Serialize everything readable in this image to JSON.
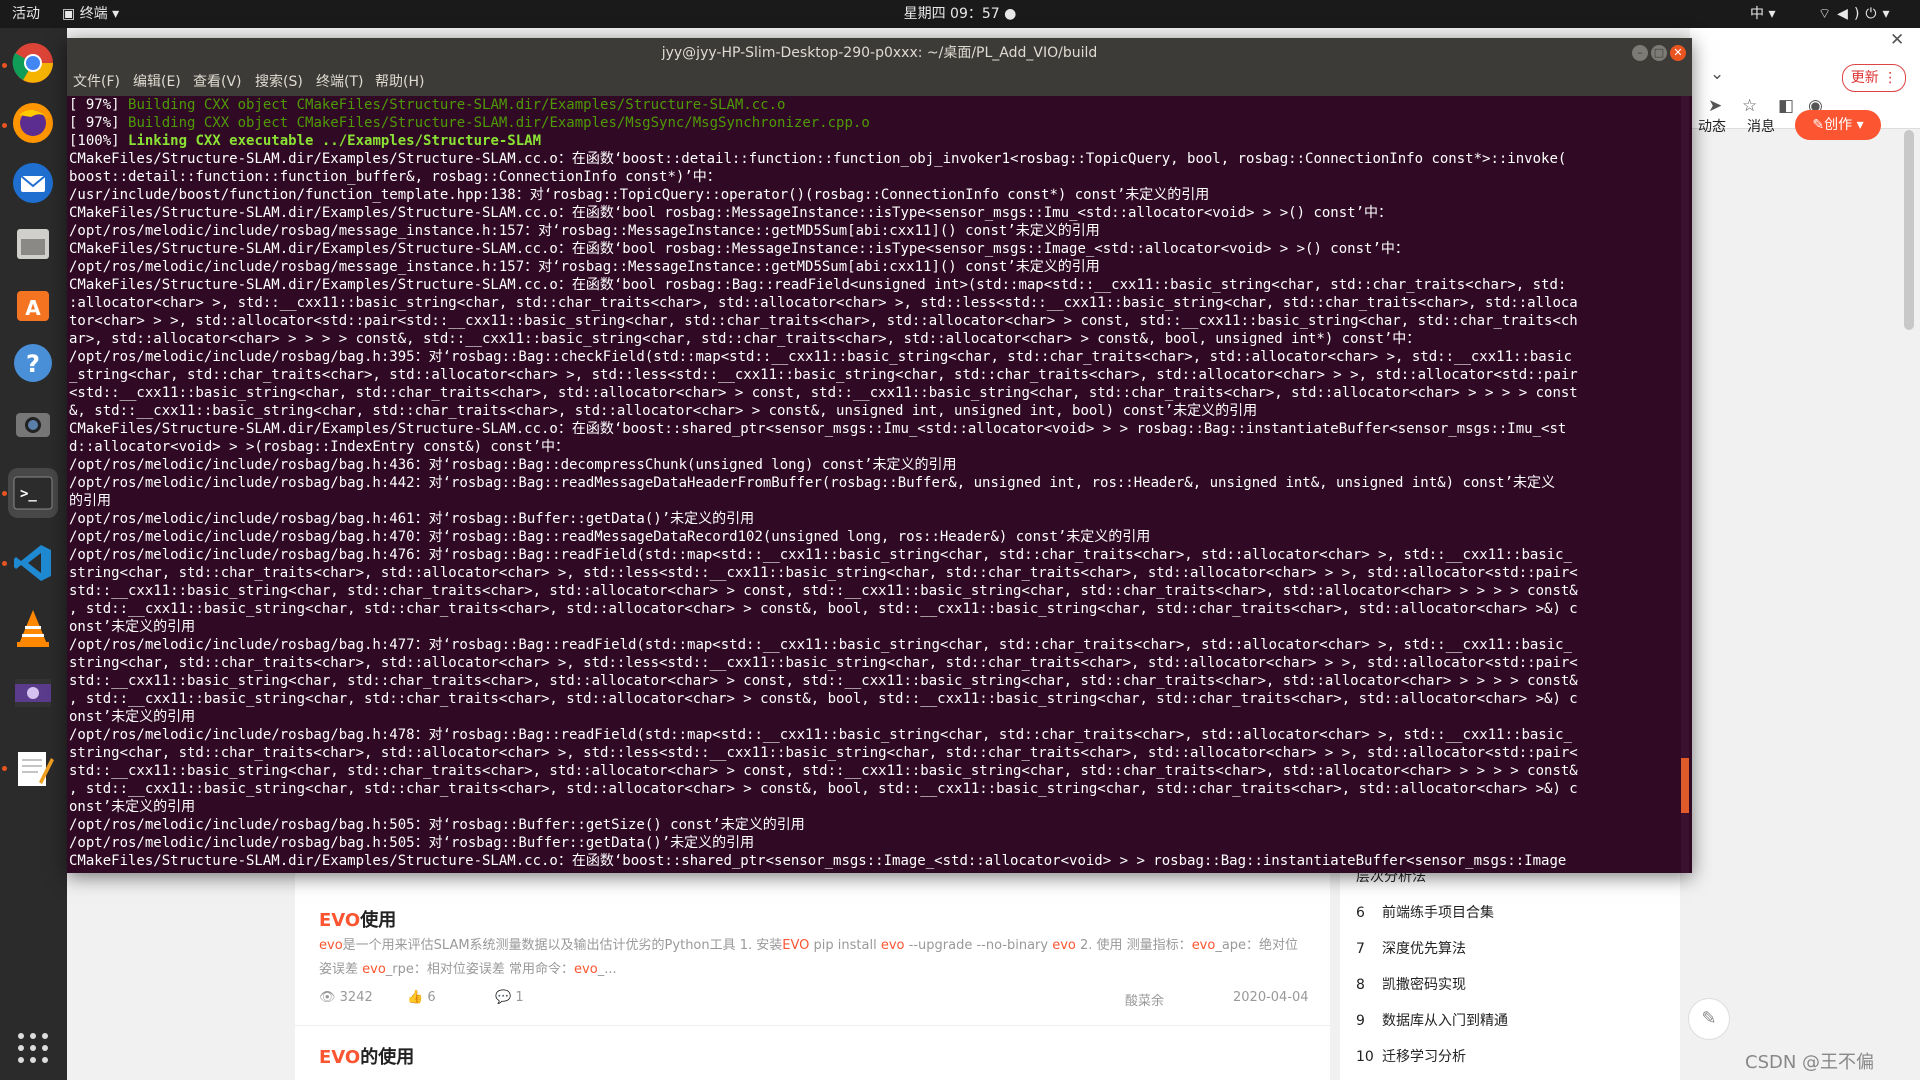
{
  "topbar": {
    "activities": "活动",
    "app": "终端",
    "clock": "星期四 09：57",
    "ime": "中",
    "icons": [
      "network-icon",
      "volume-icon",
      "power-icon"
    ]
  },
  "dock": {
    "apps": [
      "chrome-icon",
      "firefox-icon",
      "thunderbird-icon",
      "files-icon",
      "software-center-icon",
      "help-icon",
      "camera-icon",
      "terminal-icon",
      "vscode-icon",
      "vlc-icon",
      "video-icon",
      "text-editor-icon",
      "apps-grid-icon"
    ]
  },
  "browser": {
    "update_label": "更新",
    "nav_dynamic": "动态",
    "nav_messages": "消息",
    "create_label": "创作"
  },
  "terminal": {
    "title": "jyy@jyy-HP-Slim-Desktop-290-p0xxx: ~/桌面/PL_Add_VIO/build",
    "menu": [
      "文件(F)",
      "编辑(E)",
      "查看(V)",
      "搜索(S)",
      "终端(T)",
      "帮助(H)"
    ],
    "lines": [
      {
        "prefix": "[ 97%] ",
        "text": "Building CXX object CMakeFiles/Structure-SLAM.dir/Examples/Structure-SLAM.cc.o",
        "style": "green"
      },
      {
        "prefix": "[ 97%] ",
        "text": "Building CXX object CMakeFiles/Structure-SLAM.dir/Examples/MsgSync/MsgSynchronizer.cpp.o",
        "style": "green"
      },
      {
        "prefix": "[100%] ",
        "text": "Linking CXX executable ../Examples/Structure-SLAM",
        "style": "bgreen"
      },
      {
        "prefix": "",
        "text": "CMakeFiles/Structure-SLAM.dir/Examples/Structure-SLAM.cc.o：在函数‘boost::detail::function::function_obj_invoker1<rosbag::TopicQuery, bool, rosbag::ConnectionInfo const*>::invoke(",
        "style": ""
      },
      {
        "prefix": "",
        "text": "boost::detail::function::function_buffer&, rosbag::ConnectionInfo const*)’中：",
        "style": ""
      },
      {
        "prefix": "",
        "text": "/usr/include/boost/function/function_template.hpp:138：对‘rosbag::TopicQuery::operator()(rosbag::ConnectionInfo const*) const’未定义的引用",
        "style": ""
      },
      {
        "prefix": "",
        "text": "CMakeFiles/Structure-SLAM.dir/Examples/Structure-SLAM.cc.o：在函数‘bool rosbag::MessageInstance::isType<sensor_msgs::Imu_<std::allocator<void> > >() const’中：",
        "style": ""
      },
      {
        "prefix": "",
        "text": "/opt/ros/melodic/include/rosbag/message_instance.h:157：对‘rosbag::MessageInstance::getMD5Sum[abi:cxx11]() const’未定义的引用",
        "style": ""
      },
      {
        "prefix": "",
        "text": "CMakeFiles/Structure-SLAM.dir/Examples/Structure-SLAM.cc.o：在函数‘bool rosbag::MessageInstance::isType<sensor_msgs::Image_<std::allocator<void> > >() const’中：",
        "style": ""
      },
      {
        "prefix": "",
        "text": "/opt/ros/melodic/include/rosbag/message_instance.h:157：对‘rosbag::MessageInstance::getMD5Sum[abi:cxx11]() const’未定义的引用",
        "style": ""
      },
      {
        "prefix": "",
        "text": "CMakeFiles/Structure-SLAM.dir/Examples/Structure-SLAM.cc.o：在函数‘bool rosbag::Bag::readField<unsigned int>(std::map<std::__cxx11::basic_string<char, std::char_traits<char>, std:",
        "style": ""
      },
      {
        "prefix": "",
        "text": ":allocator<char> >, std::__cxx11::basic_string<char, std::char_traits<char>, std::allocator<char> >, std::less<std::__cxx11::basic_string<char, std::char_traits<char>, std::alloca",
        "style": ""
      },
      {
        "prefix": "",
        "text": "tor<char> > >, std::allocator<std::pair<std::__cxx11::basic_string<char, std::char_traits<char>, std::allocator<char> > const, std::__cxx11::basic_string<char, std::char_traits<ch",
        "style": ""
      },
      {
        "prefix": "",
        "text": "ar>, std::allocator<char> > > > > const&, std::__cxx11::basic_string<char, std::char_traits<char>, std::allocator<char> > const&, bool, unsigned int*) const’中：",
        "style": ""
      },
      {
        "prefix": "",
        "text": "/opt/ros/melodic/include/rosbag/bag.h:395：对‘rosbag::Bag::checkField(std::map<std::__cxx11::basic_string<char, std::char_traits<char>, std::allocator<char> >, std::__cxx11::basic",
        "style": ""
      },
      {
        "prefix": "",
        "text": "_string<char, std::char_traits<char>, std::allocator<char> >, std::less<std::__cxx11::basic_string<char, std::char_traits<char>, std::allocator<char> > >, std::allocator<std::pair",
        "style": ""
      },
      {
        "prefix": "",
        "text": "<std::__cxx11::basic_string<char, std::char_traits<char>, std::allocator<char> > const, std::__cxx11::basic_string<char, std::char_traits<char>, std::allocator<char> > > > > const",
        "style": ""
      },
      {
        "prefix": "",
        "text": "&, std::__cxx11::basic_string<char, std::char_traits<char>, std::allocator<char> > const&, unsigned int, unsigned int, bool) const’未定义的引用",
        "style": ""
      },
      {
        "prefix": "",
        "text": "CMakeFiles/Structure-SLAM.dir/Examples/Structure-SLAM.cc.o：在函数‘boost::shared_ptr<sensor_msgs::Imu_<std::allocator<void> > > rosbag::Bag::instantiateBuffer<sensor_msgs::Imu_<st",
        "style": ""
      },
      {
        "prefix": "",
        "text": "d::allocator<void> > >(rosbag::IndexEntry const&) const’中：",
        "style": ""
      },
      {
        "prefix": "",
        "text": "/opt/ros/melodic/include/rosbag/bag.h:436：对‘rosbag::Bag::decompressChunk(unsigned long) const’未定义的引用",
        "style": ""
      },
      {
        "prefix": "",
        "text": "/opt/ros/melodic/include/rosbag/bag.h:442：对‘rosbag::Bag::readMessageDataHeaderFromBuffer(rosbag::Buffer&, unsigned int, ros::Header&, unsigned int&, unsigned int&) const’未定义",
        "style": ""
      },
      {
        "prefix": "",
        "text": "的引用",
        "style": ""
      },
      {
        "prefix": "",
        "text": "/opt/ros/melodic/include/rosbag/bag.h:461：对‘rosbag::Buffer::getData()’未定义的引用",
        "style": ""
      },
      {
        "prefix": "",
        "text": "/opt/ros/melodic/include/rosbag/bag.h:470：对‘rosbag::Bag::readMessageDataRecord102(unsigned long, ros::Header&) const’未定义的引用",
        "style": ""
      },
      {
        "prefix": "",
        "text": "/opt/ros/melodic/include/rosbag/bag.h:476：对‘rosbag::Bag::readField(std::map<std::__cxx11::basic_string<char, std::char_traits<char>, std::allocator<char> >, std::__cxx11::basic_",
        "style": ""
      },
      {
        "prefix": "",
        "text": "string<char, std::char_traits<char>, std::allocator<char> >, std::less<std::__cxx11::basic_string<char, std::char_traits<char>, std::allocator<char> > >, std::allocator<std::pair<",
        "style": ""
      },
      {
        "prefix": "",
        "text": "std::__cxx11::basic_string<char, std::char_traits<char>, std::allocator<char> > const, std::__cxx11::basic_string<char, std::char_traits<char>, std::allocator<char> > > > > const&",
        "style": ""
      },
      {
        "prefix": "",
        "text": ", std::__cxx11::basic_string<char, std::char_traits<char>, std::allocator<char> > const&, bool, std::__cxx11::basic_string<char, std::char_traits<char>, std::allocator<char> >&) c",
        "style": ""
      },
      {
        "prefix": "",
        "text": "onst’未定义的引用",
        "style": ""
      },
      {
        "prefix": "",
        "text": "/opt/ros/melodic/include/rosbag/bag.h:477：对‘rosbag::Bag::readField(std::map<std::__cxx11::basic_string<char, std::char_traits<char>, std::allocator<char> >, std::__cxx11::basic_",
        "style": ""
      },
      {
        "prefix": "",
        "text": "string<char, std::char_traits<char>, std::allocator<char> >, std::less<std::__cxx11::basic_string<char, std::char_traits<char>, std::allocator<char> > >, std::allocator<std::pair<",
        "style": ""
      },
      {
        "prefix": "",
        "text": "std::__cxx11::basic_string<char, std::char_traits<char>, std::allocator<char> > const, std::__cxx11::basic_string<char, std::char_traits<char>, std::allocator<char> > > > > const&",
        "style": ""
      },
      {
        "prefix": "",
        "text": ", std::__cxx11::basic_string<char, std::char_traits<char>, std::allocator<char> > const&, bool, std::__cxx11::basic_string<char, std::char_traits<char>, std::allocator<char> >&) c",
        "style": ""
      },
      {
        "prefix": "",
        "text": "onst’未定义的引用",
        "style": ""
      },
      {
        "prefix": "",
        "text": "/opt/ros/melodic/include/rosbag/bag.h:478：对‘rosbag::Bag::readField(std::map<std::__cxx11::basic_string<char, std::char_traits<char>, std::allocator<char> >, std::__cxx11::basic_",
        "style": ""
      },
      {
        "prefix": "",
        "text": "string<char, std::char_traits<char>, std::allocator<char> >, std::less<std::__cxx11::basic_string<char, std::char_traits<char>, std::allocator<char> > >, std::allocator<std::pair<",
        "style": ""
      },
      {
        "prefix": "",
        "text": "std::__cxx11::basic_string<char, std::char_traits<char>, std::allocator<char> > const, std::__cxx11::basic_string<char, std::char_traits<char>, std::allocator<char> > > > > const&",
        "style": ""
      },
      {
        "prefix": "",
        "text": ", std::__cxx11::basic_string<char, std::char_traits<char>, std::allocator<char> > const&, bool, std::__cxx11::basic_string<char, std::char_traits<char>, std::allocator<char> >&) c",
        "style": ""
      },
      {
        "prefix": "",
        "text": "onst’未定义的引用",
        "style": ""
      },
      {
        "prefix": "",
        "text": "/opt/ros/melodic/include/rosbag/bag.h:505：对‘rosbag::Buffer::getSize() const’未定义的引用",
        "style": ""
      },
      {
        "prefix": "",
        "text": "/opt/ros/melodic/include/rosbag/bag.h:505：对‘rosbag::Buffer::getData()’未定义的引用",
        "style": ""
      },
      {
        "prefix": "",
        "text": "CMakeFiles/Structure-SLAM.dir/Examples/Structure-SLAM.cc.o：在函数‘boost::shared_ptr<sensor_msgs::Image_<std::allocator<void> > > rosbag::Bag::instantiateBuffer<sensor_msgs::Image",
        "style": ""
      }
    ]
  },
  "articles": [
    {
      "title_hl": "EVO",
      "title_rest": "使用",
      "desc_parts": [
        {
          "t": "evo",
          "hl": true
        },
        {
          "t": "是一个用来评估SLAM系统测量数据以及输出估计优劣的Python工具 1. 安装",
          "hl": false
        },
        {
          "t": "EVO",
          "hl": true
        },
        {
          "t": " pip install ",
          "hl": false
        },
        {
          "t": "evo",
          "hl": true
        },
        {
          "t": " --upgrade --no-binary ",
          "hl": false
        },
        {
          "t": "evo",
          "hl": true
        },
        {
          "t": " 2. 使用 测量指标：",
          "hl": false
        },
        {
          "t": "evo",
          "hl": true
        },
        {
          "t": "_ape：绝对位姿误差 ",
          "hl": false
        },
        {
          "t": "evo",
          "hl": true
        },
        {
          "t": "_rpe：相对位姿误差 常用命令：",
          "hl": false
        },
        {
          "t": "evo",
          "hl": true
        },
        {
          "t": "_...",
          "hl": false
        }
      ],
      "views": "3242",
      "likes": "6",
      "comments": "1",
      "author": "酸菜余",
      "date": "2020-04-04"
    },
    {
      "title_hl": "EVO",
      "title_rest": "的使用"
    }
  ],
  "sidebar": {
    "partial_top": "层次分析法",
    "items": [
      {
        "num": "6",
        "label": "前端练手项目合集"
      },
      {
        "num": "7",
        "label": "深度优先算法"
      },
      {
        "num": "8",
        "label": "凯撒密码实现"
      },
      {
        "num": "9",
        "label": "数据库从入门到精通"
      },
      {
        "num": "10",
        "label": "迁移学习分析"
      }
    ]
  },
  "watermark": "CSDN @王不偏"
}
